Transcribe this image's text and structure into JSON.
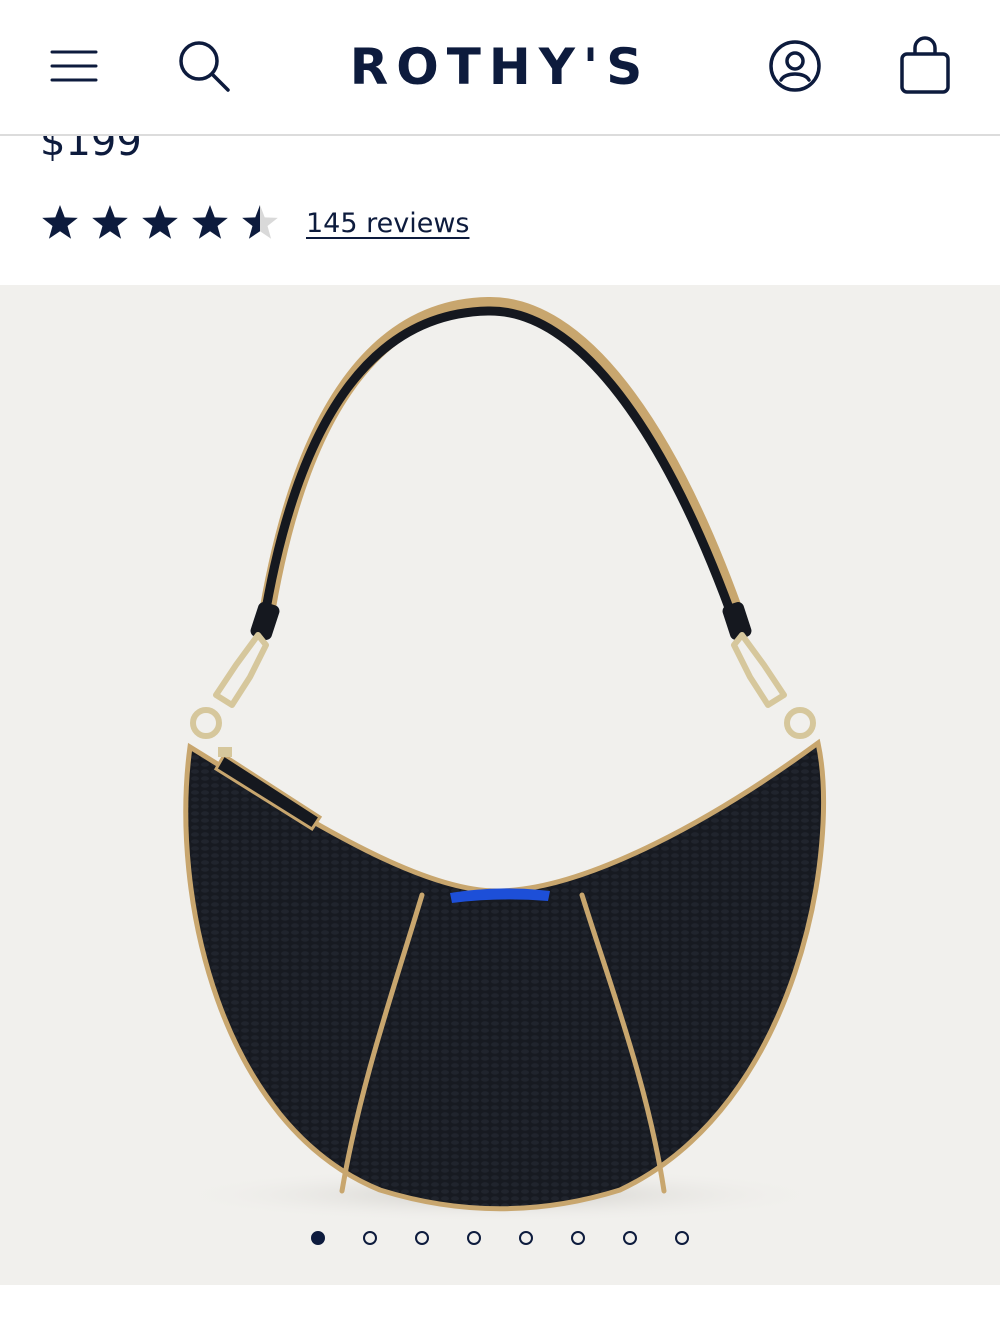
{
  "header": {
    "logo_text": "ROTHY'S",
    "menu_icon": "hamburger-menu-icon",
    "search_icon": "search-icon",
    "account_icon": "user-account-icon",
    "cart_icon": "shopping-bag-icon"
  },
  "product": {
    "price": "$199",
    "rating": 4.5,
    "rating_max": 5,
    "reviews_label": "145 reviews"
  },
  "gallery": {
    "slide_count": 8,
    "active_slide": 1,
    "background_color": "#f1f0ed"
  },
  "colors": {
    "brand_navy": "#0d1b3d",
    "bag_black": "#15181f",
    "trim_tan": "#c8a66e",
    "accent_blue": "#1d4fd8"
  }
}
